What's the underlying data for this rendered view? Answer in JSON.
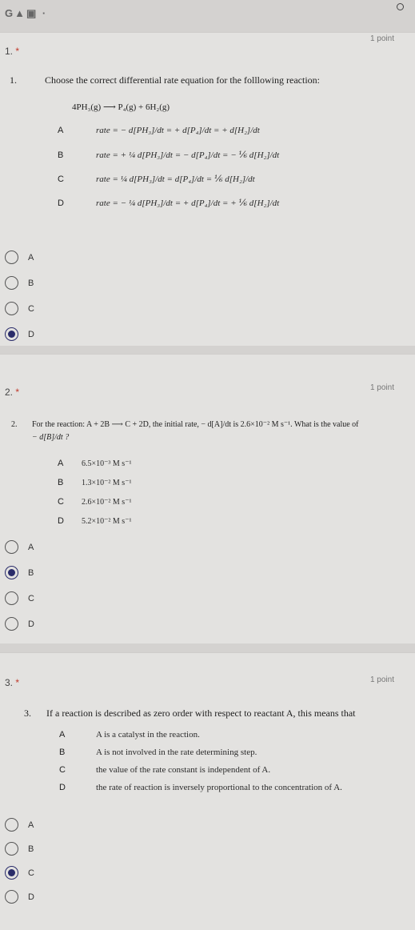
{
  "status": {
    "icons": "G▲▣ ·"
  },
  "q1": {
    "num": "1.",
    "required": "*",
    "points": "1 point",
    "stem_index": "1.",
    "text": "Choose the correct differential rate equation for the folllowing reaction:",
    "reaction": "4PH₃(g) ⟶ P₄(g) + 6H₂(g)",
    "choices": [
      {
        "letter": "A",
        "expr": "rate = − d[PH₃]/dt = + d[P₄]/dt = + d[H₂]/dt"
      },
      {
        "letter": "B",
        "expr": "rate = + ¼ d[PH₃]/dt = − d[P₄]/dt = − ⅙ d[H₂]/dt"
      },
      {
        "letter": "C",
        "expr": "rate = ¼ d[PH₃]/dt = d[P₄]/dt = ⅙ d[H₂]/dt"
      },
      {
        "letter": "D",
        "expr": "rate = − ¼ d[PH₃]/dt = + d[P₄]/dt = + ⅙ d[H₂]/dt"
      }
    ],
    "options": [
      "A",
      "B",
      "C",
      "D"
    ],
    "selected": 3
  },
  "q2": {
    "num": "2.",
    "required": "*",
    "points": "1 point",
    "stem_index": "2.",
    "text": "For the reaction: A + 2B ⟶ C + 2D, the initial rate, − d[A]/dt is 2.6×10⁻² M s⁻¹. What is the value of",
    "text2": "− d[B]/dt ?",
    "choices": [
      {
        "letter": "A",
        "expr": "6.5×10⁻³ M s⁻¹"
      },
      {
        "letter": "B",
        "expr": "1.3×10⁻² M s⁻¹"
      },
      {
        "letter": "C",
        "expr": "2.6×10⁻² M s⁻¹"
      },
      {
        "letter": "D",
        "expr": "5.2×10⁻² M s⁻¹"
      }
    ],
    "options": [
      "A",
      "B",
      "C",
      "D"
    ],
    "selected": 1
  },
  "q3": {
    "num": "3.",
    "required": "*",
    "points": "1 point",
    "stem_index": "3.",
    "text": "If a reaction is described as zero order with respect to reactant A, this means that",
    "choices": [
      {
        "letter": "A",
        "expr": "A is a catalyst in the reaction."
      },
      {
        "letter": "B",
        "expr": "A is not involved in the rate determining step."
      },
      {
        "letter": "C",
        "expr": "the value of the rate constant is independent of A."
      },
      {
        "letter": "D",
        "expr": "the rate of reaction is inversely proportional to the concentration of A."
      }
    ],
    "options": [
      "A",
      "B",
      "C",
      "D"
    ],
    "selected": 2
  }
}
